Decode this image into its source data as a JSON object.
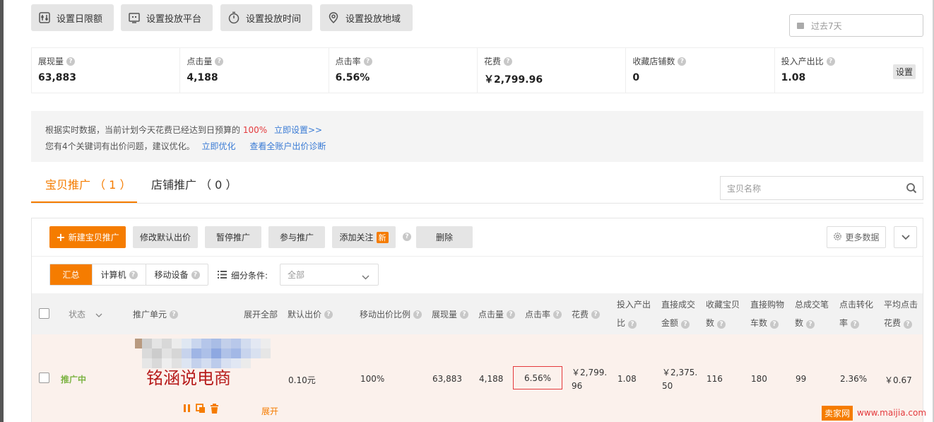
{
  "toolbar": {
    "buttons": [
      {
        "label": "设置日限额",
        "icon": "budget-icon"
      },
      {
        "label": "设置投放平台",
        "icon": "platform-icon"
      },
      {
        "label": "设置投放时间",
        "icon": "clock-icon"
      },
      {
        "label": "设置投放地域",
        "icon": "location-icon"
      }
    ],
    "date_range": "过去7天"
  },
  "stats": [
    {
      "label": "展现量",
      "value": "63,883"
    },
    {
      "label": "点击量",
      "value": "4,188"
    },
    {
      "label": "点击率",
      "value": "6.56%"
    },
    {
      "label": "花费",
      "value": "￥2,799.96"
    },
    {
      "label": "收藏店铺数",
      "value": "0"
    },
    {
      "label": "投入产出比",
      "value": "1.08",
      "action": "设置"
    }
  ],
  "notice": {
    "line1_prefix": "根据实时数据，当前计划今天花费已经达到日预算的",
    "line1_pct": "100%",
    "line1_link": "立即设置>>",
    "line2_prefix": "您有4个关键词有出价问题，建议优化。",
    "line2_link1": "立即优化",
    "line2_link2": "查看全账户出价诊断"
  },
  "tabs": [
    {
      "label": "宝贝推广 （ 1 ）",
      "active": true
    },
    {
      "label": "店铺推广 （ 0 ）",
      "active": false
    }
  ],
  "search": {
    "placeholder": "宝贝名称"
  },
  "actions": {
    "new": "新建宝贝推广",
    "modify_bid": "修改默认出价",
    "pause": "暂停推广",
    "join": "参与推广",
    "follow": "添加关注",
    "follow_badge": "新",
    "delete": "删除",
    "more_data": "更多数据"
  },
  "segments": [
    "汇总",
    "计算机",
    "移动设备"
  ],
  "filter": {
    "label": "细分条件:",
    "value": "全部"
  },
  "columns": {
    "status": "状态",
    "unit": "推广单元",
    "expand_all": "展开全部",
    "default_bid": "默认出价",
    "mobile_ratio": "移动出价比例",
    "impressions": "展现量",
    "clicks": "点击量",
    "ctr": "点击率",
    "cost": "花费",
    "roi_1": "投入产出",
    "roi_2": "比",
    "direct_amount_1": "直接成交",
    "direct_amount_2": "金额",
    "fav_items_1": "收藏宝贝",
    "fav_items_2": "数",
    "direct_cart_1": "直接购物",
    "direct_cart_2": "车数",
    "total_orders_1": "总成交笔",
    "total_orders_2": "数",
    "cvr_1": "点击转化",
    "cvr_2": "率",
    "avg_cpc_1": "平均点击",
    "avg_cpc_2": "花费"
  },
  "row": {
    "status": "推广中",
    "unit_name": "铭涵说电商",
    "expand": "展开",
    "default_bid": "0.10元",
    "mobile_ratio": "100%",
    "impressions": "63,883",
    "clicks": "4,188",
    "ctr": "6.56%",
    "cost_1": "￥2,799.",
    "cost_2": "96",
    "roi": "1.08",
    "direct_amount_1": "￥2,375.",
    "direct_amount_2": "50",
    "fav_items": "116",
    "direct_cart": "180",
    "total_orders": "99",
    "cvr": "2.36%",
    "avg_cpc": "￥0.67"
  },
  "site_watermark": {
    "logo": "卖家网",
    "url": "www.maijia.com"
  },
  "colors": {
    "accent": "#f57c00",
    "danger": "#e4393c",
    "link": "#3a7bd5",
    "status_green": "#7cb342"
  }
}
